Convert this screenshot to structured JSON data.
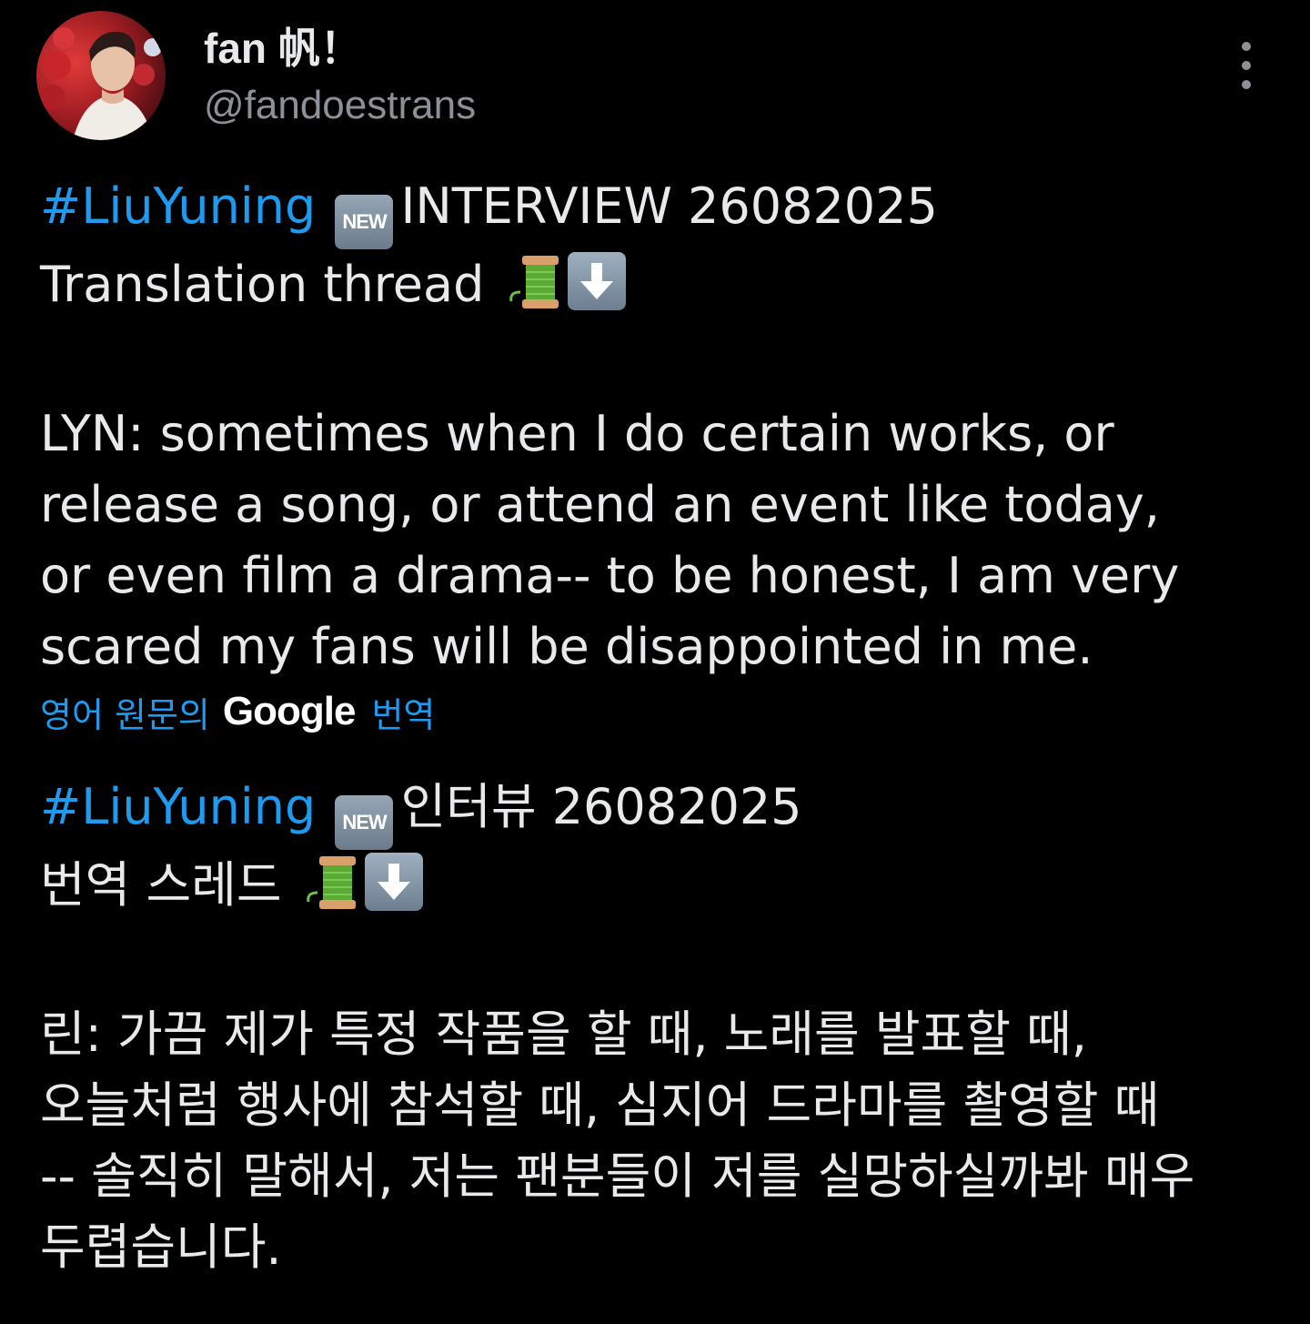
{
  "author": {
    "display_name": "fan 帆！",
    "handle": "@fandoestrans"
  },
  "post": {
    "hashtag": "#LiuYuning",
    "new_badge": "NEW",
    "title_rest": "INTERVIEW 26082025",
    "thread_label": "Translation thread",
    "body_lines": [
      "LYN: sometimes when I do certain works, or",
      "release a song, or attend an event like today,",
      "or even film a drama-- to be honest, I am very",
      "scared my fans will be disappointed in me."
    ]
  },
  "translation_notice": {
    "prefix": "영어 원문의",
    "brand": "Google",
    "suffix": "번역"
  },
  "translated": {
    "hashtag": "#LiuYuning",
    "new_badge": "NEW",
    "title_rest": "인터뷰 26082025",
    "thread_label": "번역 스레드",
    "body_lines": [
      "린: 가끔 제가 특정 작품을 할 때, 노래를 발표할 때,",
      "오늘처럼 행사에 참석할 때, 심지어 드라마를 촬영할 때",
      "-- 솔직히 말해서, 저는 팬분들이 저를 실망하실까봐 매우",
      "두렵습니다."
    ]
  },
  "icons": {
    "more": "more-vertical-icon",
    "spool": "thread-spool-emoji",
    "down_arrow": "down-arrow-emoji"
  },
  "colors": {
    "background": "#000000",
    "text": "#e7e9ea",
    "secondary": "#8b9196",
    "accent": "#1d9bf0"
  }
}
